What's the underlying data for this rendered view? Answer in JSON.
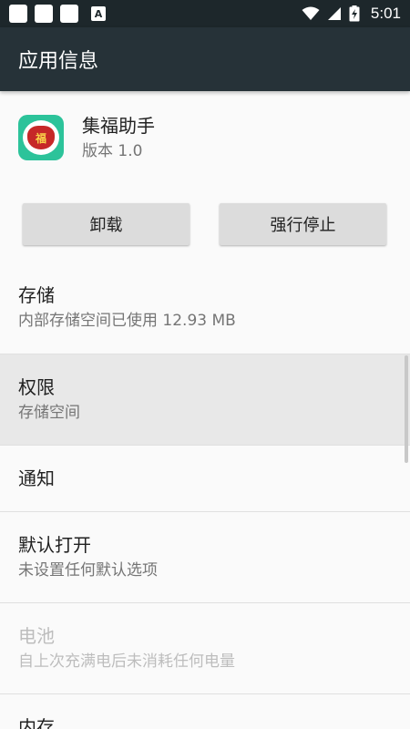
{
  "status_bar": {
    "time": "5:01",
    "badge_letter": "A",
    "icons": [
      "notification-square-icon",
      "notification-square-icon",
      "notification-square-icon",
      "a-notification-icon",
      "wifi-icon",
      "signal-icon",
      "battery-charging-icon"
    ]
  },
  "app_bar": {
    "title": "应用信息"
  },
  "app": {
    "name": "集福助手",
    "version": "版本 1.0",
    "icon_glyph": "福",
    "icon_bg": "#2cc39a"
  },
  "buttons": {
    "uninstall": "卸载",
    "force_stop": "强行停止"
  },
  "rows": {
    "storage": {
      "title": "存储",
      "subtitle": "内部存储空间已使用 12.93 MB"
    },
    "permissions": {
      "title": "权限",
      "subtitle": "存储空间"
    },
    "notifications": {
      "title": "通知"
    },
    "open_by_default": {
      "title": "默认打开",
      "subtitle": "未设置任何默认选项"
    },
    "battery": {
      "title": "电池",
      "subtitle": "自上次充满电后未消耗任何电量"
    },
    "memory": {
      "title": "内存"
    }
  },
  "colors": {
    "status_bar": "#1d272b",
    "app_bar": "#263238",
    "background": "#fafafa",
    "button": "#dcdcdc"
  }
}
